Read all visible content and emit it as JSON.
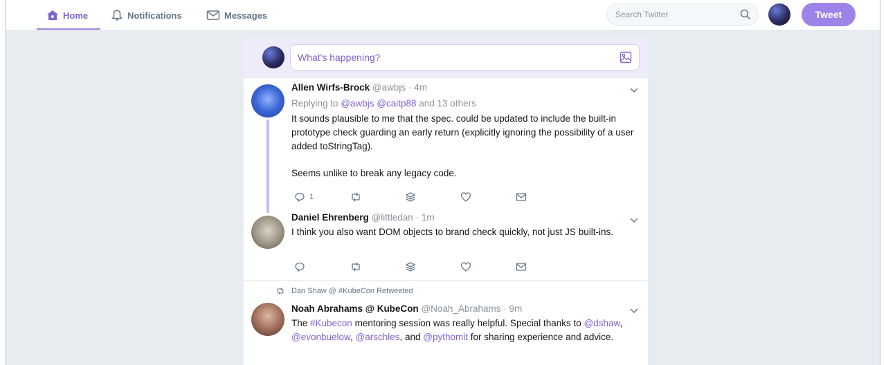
{
  "nav": {
    "home": "Home",
    "notifications": "Notifications",
    "messages": "Messages",
    "search_placeholder": "Search Twitter",
    "tweet_button": "Tweet"
  },
  "compose": {
    "placeholder": "What's happening?"
  },
  "tweets": [
    {
      "name": "Allen Wirfs-Brock",
      "handle": "@awbjs",
      "time": "4m",
      "replying_prefix": "Replying to ",
      "replying_users": "@awbjs @caitp88",
      "replying_suffix": " and 13 others",
      "text_p1": "It sounds plausible to me that the spec. could be updated to include the built-in prototype check guarding an early return (explicitly ignoring the possibility of a user added toStringTag).",
      "text_p2": "Seems unlike to break any legacy code.",
      "reply_count": "1"
    },
    {
      "name": "Daniel Ehrenberg",
      "handle": "@littledan",
      "time": "1m",
      "text": "I think you also want DOM objects to brand check quickly, not just JS built-ins."
    },
    {
      "retweeted_by": "Dan Shaw @ #KubeCon Retweeted",
      "name": "Noah Abrahams @ KubeCon",
      "handle": "@Noah_Abrahams",
      "time": "9m",
      "text_a": "The ",
      "hashtag": "#Kubecon",
      "text_b": " mentoring session was really helpful. Special thanks to ",
      "mention1": "@dshaw",
      "sep1": ", ",
      "mention2": "@evonbuelow",
      "sep2": ", ",
      "mention3": "@arschles",
      "sep3": ", and ",
      "mention4": "@pythomit",
      "text_c": " for sharing experience and advice."
    }
  ],
  "meta_dot": "·",
  "colors": {
    "accent": "#7f62d1",
    "tweet_button": "#9d83e8",
    "background": "#e6ecf0"
  },
  "icons": [
    "home-icon",
    "bell-icon",
    "envelope-icon",
    "search-icon",
    "image-icon",
    "chevron-down-icon",
    "reply-icon",
    "retweet-icon",
    "stack-icon",
    "heart-icon",
    "mail-icon"
  ]
}
